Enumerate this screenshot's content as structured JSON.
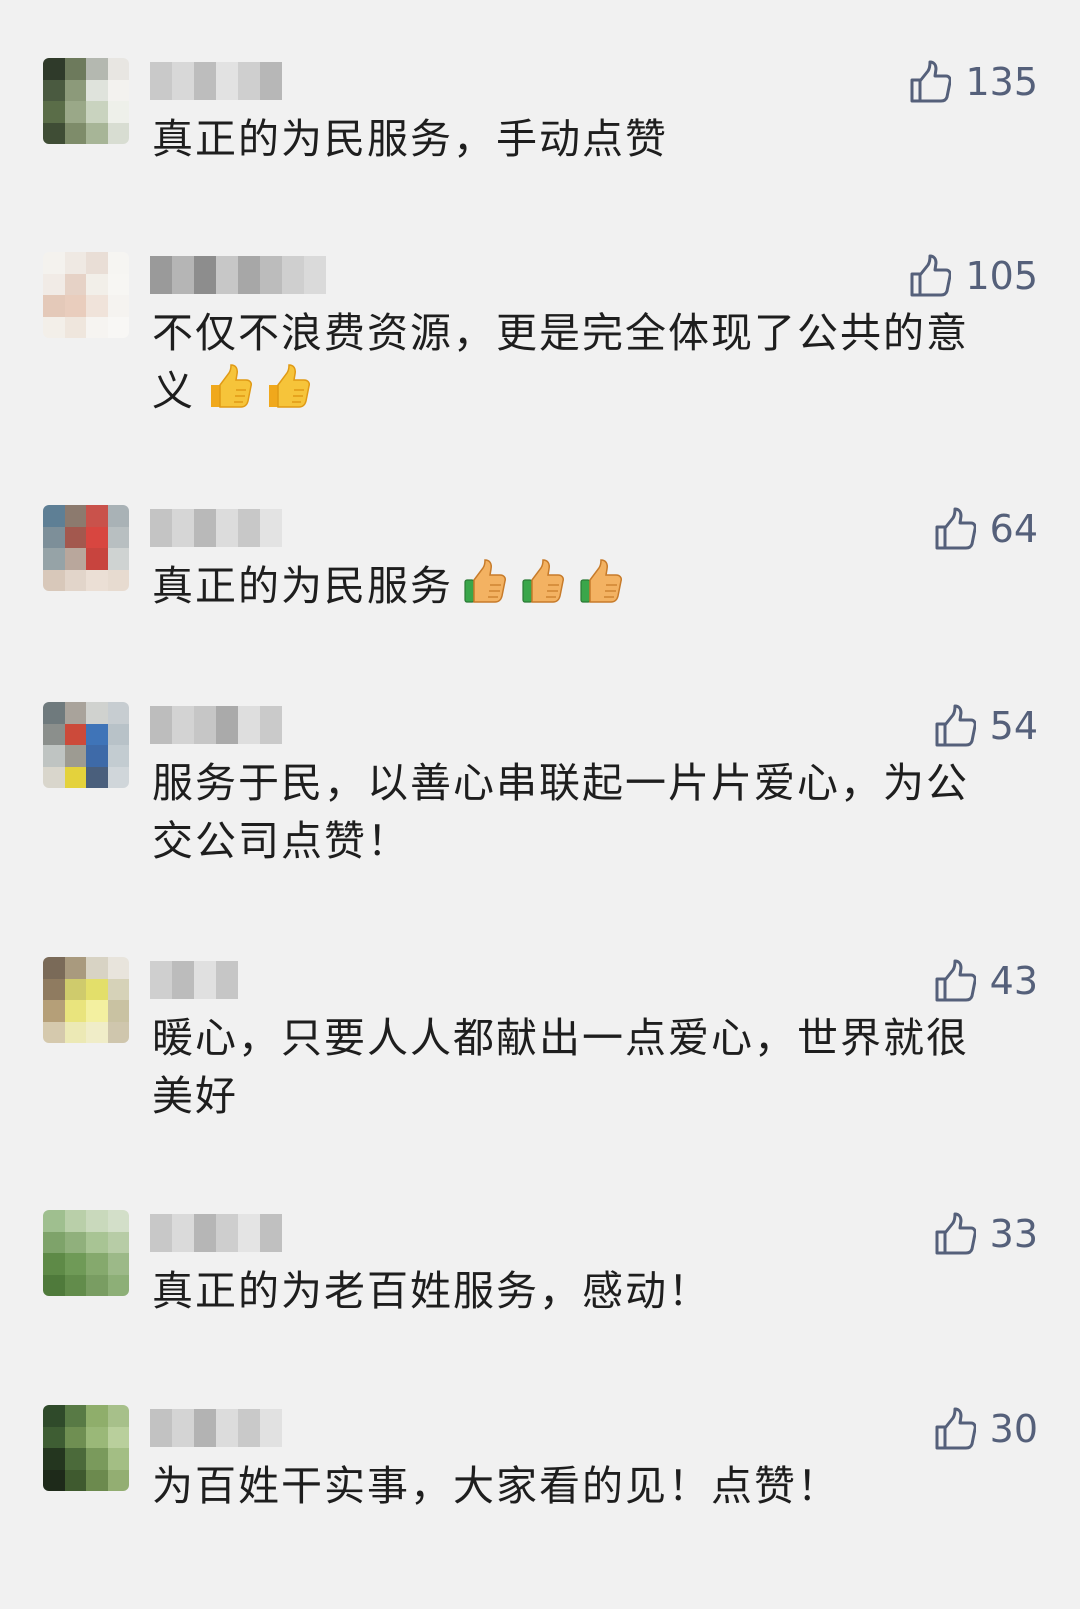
{
  "comments": [
    {
      "likes": "135",
      "text": "真正的为民服务，手动点赞",
      "emoji": [],
      "emoji_style": "",
      "avatar_palette": [
        "#2f3a2a",
        "#6d7a5c",
        "#b4b8b0",
        "#e8e6e2",
        "#4a5a40",
        "#8c9a7a",
        "#dfe3dc",
        "#f3f2ef",
        "#5a6d48",
        "#9aa888",
        "#c9d3bf",
        "#eef0ea",
        "#3f4d35",
        "#7e8c6a",
        "#a7b597",
        "#d8ddd2"
      ],
      "name_palette": [
        "#c9c9c9",
        "#d8d8d8",
        "#bdbdbd",
        "#e2e2e2",
        "#cfcfcf",
        "#b7b7b7"
      ]
    },
    {
      "likes": "105",
      "text": "不仅不浪费资源，更是完全体现了公共的意义",
      "emoji": [
        "thumbs-up",
        "thumbs-up"
      ],
      "emoji_style": "yellow",
      "avatar_palette": [
        "#f4f2ee",
        "#efe9e3",
        "#e9ded6",
        "#f6f5f2",
        "#f1ebe6",
        "#e6d2c6",
        "#f2efe9",
        "#f7f6f3",
        "#e4c9b9",
        "#e9cdbd",
        "#f0e3da",
        "#f5f3f0",
        "#f3efe9",
        "#efe6dd",
        "#f6f4f1",
        "#f8f7f5"
      ],
      "name_palette": [
        "#9a9a9a",
        "#b5b5b5",
        "#8d8d8d",
        "#c7c7c7",
        "#a7a7a7",
        "#bcbcbc",
        "#cfcfcf",
        "#dadada"
      ]
    },
    {
      "likes": "64",
      "text": "真正的为民服务",
      "emoji": [
        "thumbs-up",
        "thumbs-up",
        "thumbs-up"
      ],
      "emoji_style": "classic",
      "avatar_palette": [
        "#5e7f95",
        "#8c7a6e",
        "#c9524b",
        "#a9b2b6",
        "#7d8f99",
        "#a3584e",
        "#d84640",
        "#b8bfc1",
        "#96a3a7",
        "#b9a79c",
        "#c8443e",
        "#cfd3d2",
        "#d8c8ba",
        "#e2d5ca",
        "#ebdfd5",
        "#e7dbd0"
      ],
      "name_palette": [
        "#c4c4c4",
        "#d6d6d6",
        "#b9b9b9",
        "#dcdcdc",
        "#c8c8c8",
        "#e3e3e3"
      ]
    },
    {
      "likes": "54",
      "text": "服务于民，以善心串联起一片片爱心，为公交公司点赞！",
      "emoji": [],
      "emoji_style": "",
      "avatar_palette": [
        "#6f7a7d",
        "#a9a39b",
        "#d0d2cf",
        "#c7cdd1",
        "#8b8f8c",
        "#cc4a3a",
        "#3f74b8",
        "#b8c2c8",
        "#bfc4c2",
        "#9d9b92",
        "#3e6aa8",
        "#c3ccd1",
        "#d9d6cc",
        "#e4d23c",
        "#4a5f7c",
        "#d0d6da"
      ],
      "name_palette": [
        "#bdbdbd",
        "#d3d3d3",
        "#c6c6c6",
        "#aaaaaa",
        "#dedede",
        "#cacaca"
      ]
    },
    {
      "likes": "43",
      "text": "暖心，只要人人都献出一点爱心，世界就很美好",
      "emoji": [],
      "emoji_style": "",
      "avatar_palette": [
        "#7a6a58",
        "#a99a7e",
        "#d8d3c4",
        "#e8e4dc",
        "#8f7b60",
        "#cfcb6c",
        "#e3df6a",
        "#d6d2b8",
        "#b59f78",
        "#e9e47d",
        "#f3f0a0",
        "#c9c2a2",
        "#d5c9ad",
        "#ece9b5",
        "#f0edc8",
        "#cfc6ad"
      ],
      "name_palette": [
        "#cfcfcf",
        "#bcbcbc",
        "#e0e0e0",
        "#c6c6c6"
      ]
    },
    {
      "likes": "33",
      "text": "真正的为老百姓服务，感动！",
      "emoji": [],
      "emoji_style": "",
      "avatar_palette": [
        "#9fbf8f",
        "#b9cfa9",
        "#c9d9bc",
        "#d3dfc9",
        "#7ea36a",
        "#90b07c",
        "#a8c494",
        "#b7cca6",
        "#5e8a47",
        "#6f9a57",
        "#85a96d",
        "#9cb988",
        "#4f7a3b",
        "#628c4b",
        "#799d62",
        "#8daf77"
      ],
      "name_palette": [
        "#c8c8c8",
        "#dadada",
        "#b6b6b6",
        "#cecece",
        "#e4e4e4",
        "#c0c0c0"
      ]
    },
    {
      "likes": "30",
      "text": "为百姓干实事，大家看的见！点赞！",
      "emoji": [],
      "emoji_style": "",
      "avatar_palette": [
        "#2f4a2a",
        "#587a45",
        "#8fae6b",
        "#a7c08a",
        "#3e5d33",
        "#6f8f52",
        "#9ab878",
        "#b9cf9c",
        "#24361f",
        "#4b6a3a",
        "#7a9a5c",
        "#a3be84",
        "#1e2a1a",
        "#3f5a2f",
        "#6c8a4e",
        "#93ae72"
      ],
      "name_palette": [
        "#c2c2c2",
        "#d4d4d4",
        "#b3b3b3",
        "#dcdcdc",
        "#c9c9c9",
        "#e1e1e1"
      ]
    }
  ]
}
